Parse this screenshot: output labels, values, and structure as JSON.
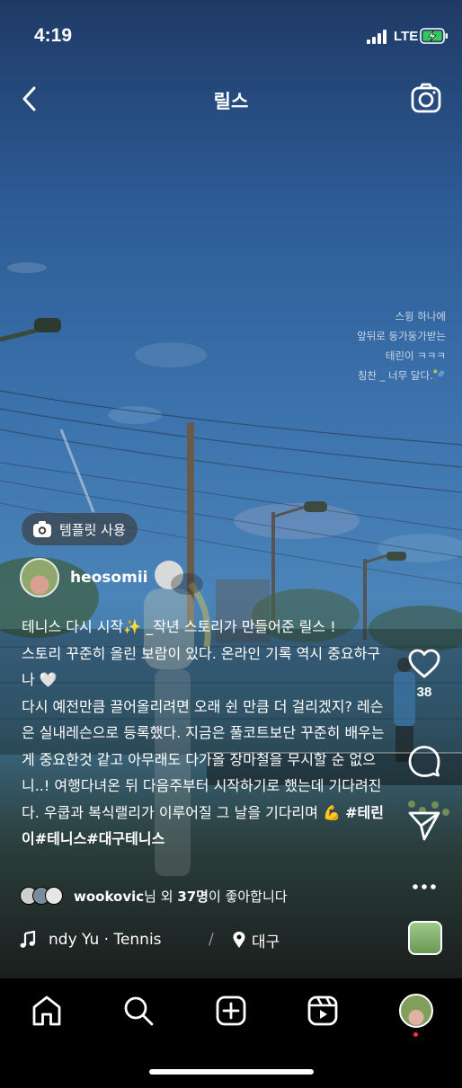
{
  "status": {
    "time": "4:19",
    "network": "LTE"
  },
  "header": {
    "title": "릴스"
  },
  "overlay_text": [
    "스윙 하나에",
    "앞뒤로 둥가둥가받는",
    "테린이 ㅋㅋㅋ",
    "칭찬 _ 너무 달다.🎾"
  ],
  "template_button": {
    "label": "템플릿 사용"
  },
  "user": {
    "username": "heosomii"
  },
  "caption": {
    "text": "테니스 다시 시작✨ _작년 스토리가 만들어준 릴스 !\n스토리 꾸준히 올린 보람이 있다. 온라인 기록 역시 중요하구나 🤍\n다시 예전만큼 끌어올리려면 오래 쉰 만큼 더 걸리겠지? 레슨은 실내레슨으로 등록했다. 지금은 풀코트보단 꾸준히 배우는게 중요한것 같고 아무래도 다가올 장마철을 무시할 순 없으니..! 여행다녀온 뒤 다음주부터 시작하기로 했는데 기다려진다. 우쿱과 복식랠리가 이루어질 그 날을 기다리며 💪 ",
    "hashtags": "#테린이#테니스#대구테니스"
  },
  "actions": {
    "like_count": "38"
  },
  "likes": {
    "user": "wookovic",
    "suffix1": "님 외 ",
    "count": "37명",
    "suffix2": "이 좋아합니다"
  },
  "music": {
    "song": "ndy Yu · Tennis",
    "location": "대구"
  },
  "icons": {
    "back": "chevron-left-icon",
    "camera": "camera-icon",
    "like": "heart-icon",
    "comment": "comment-icon",
    "share": "send-icon",
    "more": "more-icon",
    "music": "music-note-icon",
    "location": "location-pin-icon",
    "home": "home-icon",
    "search": "search-icon",
    "create": "add-icon",
    "reels": "reels-icon"
  },
  "colors": {
    "notification_dot": "#ff3040",
    "background": "#000000"
  }
}
